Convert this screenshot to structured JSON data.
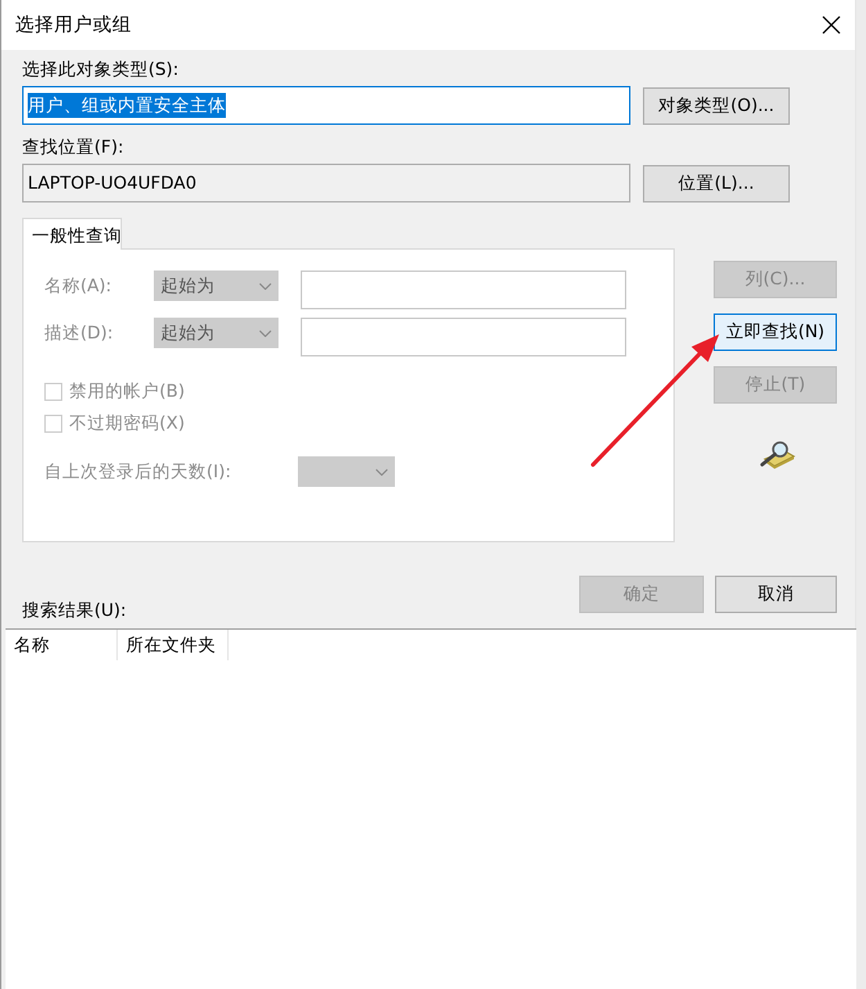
{
  "window": {
    "title": "选择用户或组"
  },
  "object_type": {
    "label": "选择此对象类型(S):",
    "value": "用户、组或内置安全主体",
    "text_selected": true,
    "button": "对象类型(O)..."
  },
  "location": {
    "label": "查找位置(F):",
    "value": "LAPTOP-UO4UFDA0",
    "button": "位置(L)..."
  },
  "tabs": [
    {
      "label": "一般性查询",
      "selected": true
    }
  ],
  "query_rows": [
    {
      "label": "名称(A):",
      "mode": "起始为",
      "disabled": true
    },
    {
      "label": "描述(D):",
      "mode": "起始为",
      "disabled": true
    }
  ],
  "checkboxes": [
    {
      "label": "禁用的帐户(B)",
      "checked": false,
      "disabled": true
    },
    {
      "label": "不过期密码(X)",
      "checked": false,
      "disabled": true
    }
  ],
  "days": {
    "label": "自上次登录后的天数(I):",
    "disabled": true
  },
  "side_buttons": [
    {
      "label": "列(C)...",
      "disabled": true,
      "focused": false
    },
    {
      "label": "立即查找(N)",
      "disabled": false,
      "focused": true
    },
    {
      "label": "停止(T)",
      "disabled": true,
      "focused": false
    }
  ],
  "dialog_buttons": [
    {
      "label": "确定",
      "disabled": true
    },
    {
      "label": "取消",
      "disabled": false
    }
  ],
  "results": {
    "label": "搜索结果(U):",
    "columns": [
      "名称",
      "所在文件夹"
    ]
  }
}
